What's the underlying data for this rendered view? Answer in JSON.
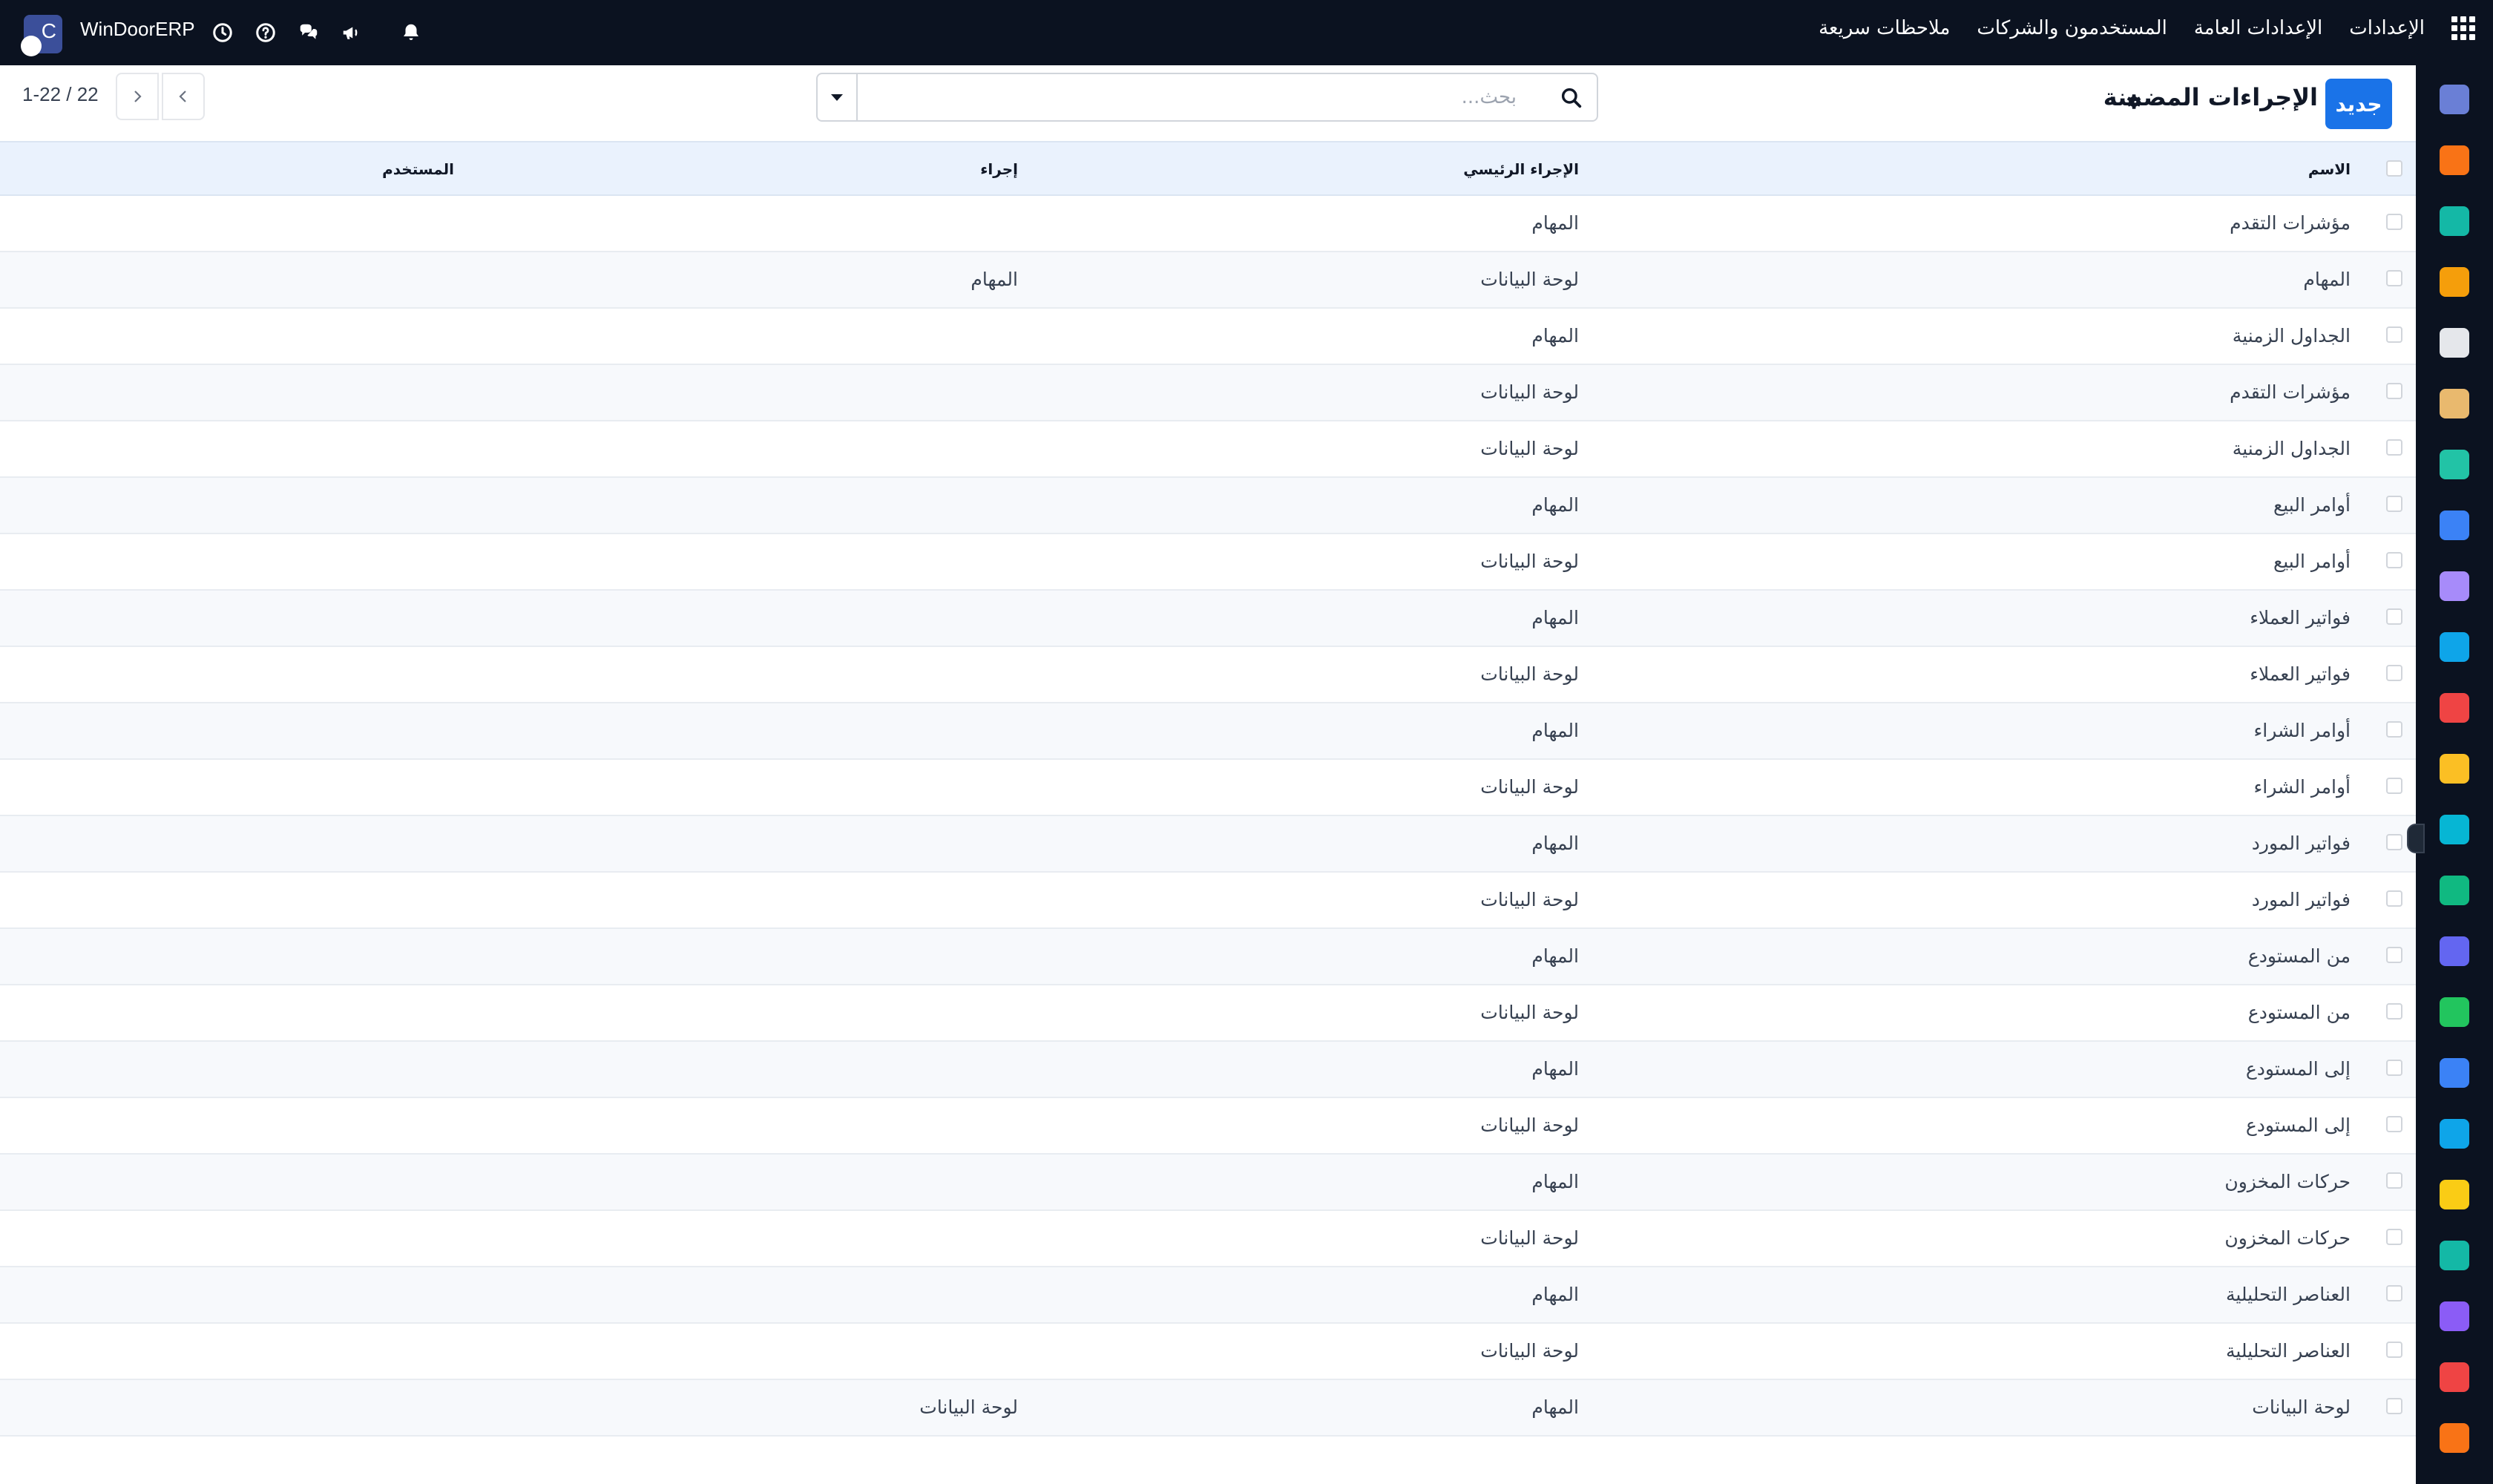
{
  "app": {
    "name": "WinDoorERP",
    "logo_letter": "C"
  },
  "top_menu": [
    "الإعدادات",
    "الإعدادات العامة",
    "المستخدمون والشركات",
    "ملاحظات سريعة"
  ],
  "top_icons": [
    "clock-icon",
    "help-icon",
    "chat-icon",
    "megaphone-icon",
    "bell-icon"
  ],
  "control": {
    "new_label": "جديد",
    "title": "الإجراءات المضمنة",
    "search_placeholder": "بحث...",
    "pager_counter": "1-22 / 22"
  },
  "table": {
    "headers": {
      "name": "الاسم",
      "parent": "الإجراء الرئيسي",
      "action": "إجراء",
      "user": "المستخدم"
    },
    "rows": [
      {
        "name": "مؤشرات التقدم",
        "parent": "المهام",
        "action": "",
        "user": ""
      },
      {
        "name": "المهام",
        "parent": "لوحة البيانات",
        "action": "المهام",
        "user": ""
      },
      {
        "name": "الجداول الزمنية",
        "parent": "المهام",
        "action": "",
        "user": ""
      },
      {
        "name": "مؤشرات التقدم",
        "parent": "لوحة البيانات",
        "action": "",
        "user": ""
      },
      {
        "name": "الجداول الزمنية",
        "parent": "لوحة البيانات",
        "action": "",
        "user": ""
      },
      {
        "name": "أوامر البيع",
        "parent": "المهام",
        "action": "",
        "user": ""
      },
      {
        "name": "أوامر البيع",
        "parent": "لوحة البيانات",
        "action": "",
        "user": ""
      },
      {
        "name": "فواتير العملاء",
        "parent": "المهام",
        "action": "",
        "user": ""
      },
      {
        "name": "فواتير العملاء",
        "parent": "لوحة البيانات",
        "action": "",
        "user": ""
      },
      {
        "name": "أوامر الشراء",
        "parent": "المهام",
        "action": "",
        "user": ""
      },
      {
        "name": "أوامر الشراء",
        "parent": "لوحة البيانات",
        "action": "",
        "user": ""
      },
      {
        "name": "فواتير المورد",
        "parent": "المهام",
        "action": "",
        "user": ""
      },
      {
        "name": "فواتير المورد",
        "parent": "لوحة البيانات",
        "action": "",
        "user": ""
      },
      {
        "name": "من المستودع",
        "parent": "المهام",
        "action": "",
        "user": ""
      },
      {
        "name": "من المستودع",
        "parent": "لوحة البيانات",
        "action": "",
        "user": ""
      },
      {
        "name": "إلى المستودع",
        "parent": "المهام",
        "action": "",
        "user": ""
      },
      {
        "name": "إلى المستودع",
        "parent": "لوحة البيانات",
        "action": "",
        "user": ""
      },
      {
        "name": "حركات المخزون",
        "parent": "المهام",
        "action": "",
        "user": ""
      },
      {
        "name": "حركات المخزون",
        "parent": "لوحة البيانات",
        "action": "",
        "user": ""
      },
      {
        "name": "العناصر التحليلية",
        "parent": "المهام",
        "action": "",
        "user": ""
      },
      {
        "name": "العناصر التحليلية",
        "parent": "لوحة البيانات",
        "action": "",
        "user": ""
      },
      {
        "name": "لوحة البيانات",
        "parent": "المهام",
        "action": "لوحة البيانات",
        "user": ""
      }
    ]
  },
  "sidebar_apps": [
    {
      "icon": "mail-app-icon",
      "color": "#6a7fd6"
    },
    {
      "icon": "discuss-app-icon",
      "color": "#f97316"
    },
    {
      "icon": "documents-app-icon",
      "color": "#14b8a6"
    },
    {
      "icon": "reporting-app-icon",
      "color": "#f59e0b"
    },
    {
      "icon": "inventory-box-icon",
      "color": "#e5e7eb"
    },
    {
      "icon": "contacts-app-icon",
      "color": "#e9b96e"
    },
    {
      "icon": "project-check-icon",
      "color": "#22c3a6"
    },
    {
      "icon": "knowledge-app-icon",
      "color": "#3b82f6"
    },
    {
      "icon": "products-app-icon",
      "color": "#a78bfa"
    },
    {
      "icon": "invoicing-app-icon",
      "color": "#0ea5e9"
    },
    {
      "icon": "employees-app-icon",
      "color": "#ef4444"
    },
    {
      "icon": "calendar-app-icon",
      "color": "#fbbf24"
    },
    {
      "icon": "sign-app-icon",
      "color": "#06b6d4"
    },
    {
      "icon": "crm-app-icon",
      "color": "#10b981"
    },
    {
      "icon": "dashboards-app-icon",
      "color": "#6366f1"
    },
    {
      "icon": "whatsapp-app-icon",
      "color": "#22c55e"
    },
    {
      "icon": "timesheet-app-icon",
      "color": "#3b82f6"
    },
    {
      "icon": "website-app-icon",
      "color": "#0ea5e9"
    },
    {
      "icon": "email-marketing-icon",
      "color": "#facc15"
    },
    {
      "icon": "accounting-app-icon",
      "color": "#14b8a6"
    },
    {
      "icon": "purchase-app-icon",
      "color": "#8b5cf6"
    },
    {
      "icon": "sales-app-icon",
      "color": "#ef4444"
    },
    {
      "icon": "settings-app-icon",
      "color": "#f97316"
    }
  ]
}
